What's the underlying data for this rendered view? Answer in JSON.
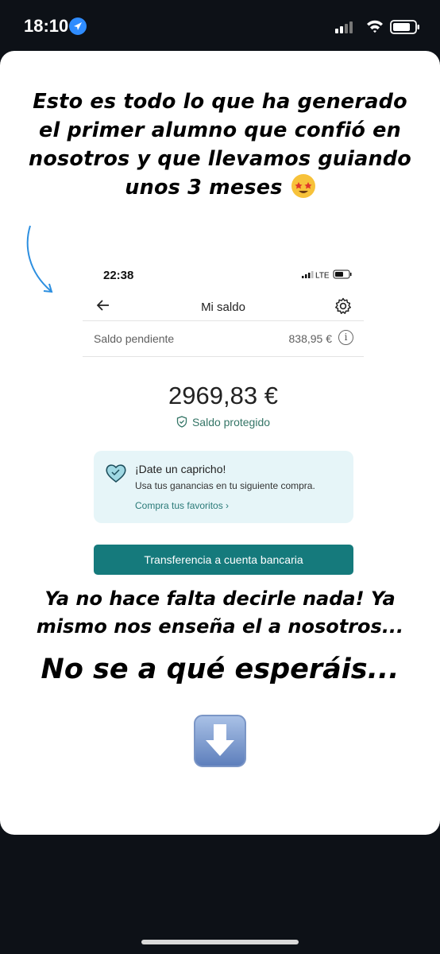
{
  "status_bar": {
    "time": "18:10",
    "location_icon": "location-arrow-icon",
    "signal_icon": "cellular-signal-icon",
    "wifi_icon": "wifi-icon",
    "battery_icon": "battery-icon"
  },
  "story": {
    "headline": "Esto es todo lo que ha generado el primer alumno que confió en nosotros y que llevamos guiando unos 3 meses",
    "headline_emoji": "star-struck-emoji",
    "subtext": "Ya no hace falta decirle nada! Ya mismo nos enseña el a nosotros...",
    "big_text": "No se a qué esperáis...",
    "bottom_emoji": "down-arrow-emoji"
  },
  "screenshot": {
    "time": "22:38",
    "network": "LTE",
    "nav_title": "Mi saldo",
    "pending_label": "Saldo pendiente",
    "pending_value": "838,95 €",
    "balance": "2969,83 €",
    "protected_label": "Saldo protegido",
    "promo_title": "¡Date un capricho!",
    "promo_text": "Usa tus ganancias en tu siguiente compra.",
    "promo_link": "Compra tus favoritos ›",
    "transfer_button": "Transferencia a cuenta bancaria"
  },
  "colors": {
    "accent_teal": "#157a7c",
    "protected_green": "#347566",
    "promo_bg": "#e6f5f8",
    "arrow_blue": "#2d8fe0"
  }
}
